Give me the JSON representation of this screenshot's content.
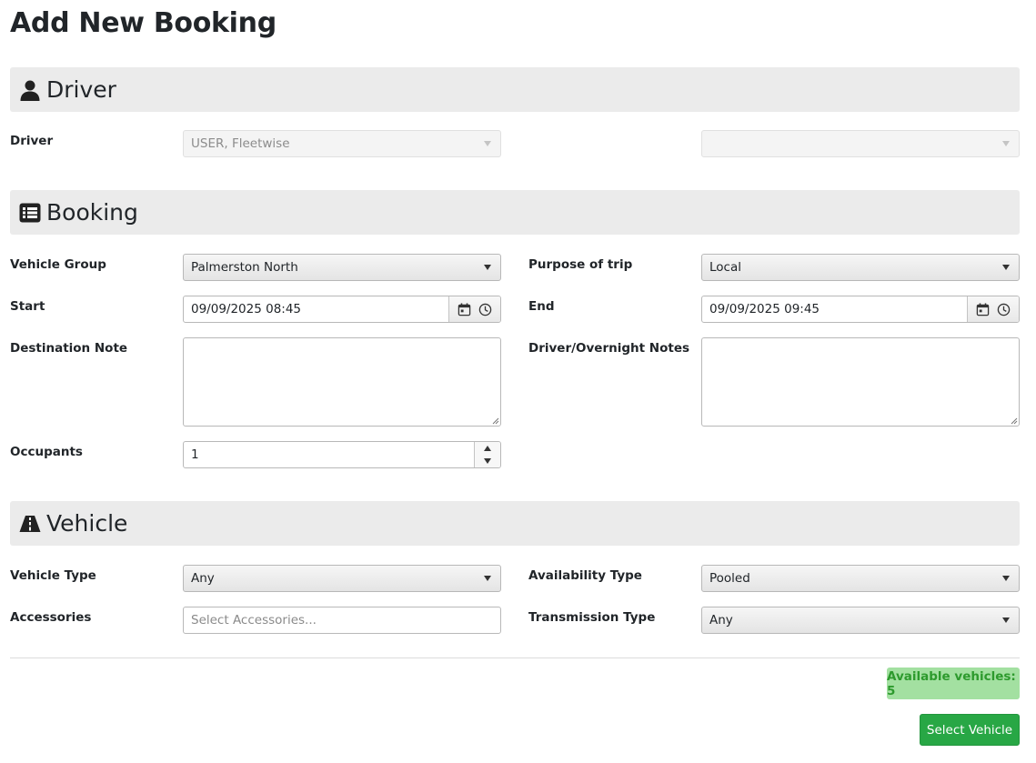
{
  "page": {
    "title": "Add New Booking"
  },
  "sections": {
    "driver": {
      "title": "Driver",
      "icon": "user-icon"
    },
    "booking": {
      "title": "Booking",
      "icon": "list-icon"
    },
    "vehicle": {
      "title": "Vehicle",
      "icon": "road-icon"
    }
  },
  "driver": {
    "label": "Driver",
    "selected": "USER, Fleetwise",
    "secondary_selected": ""
  },
  "booking": {
    "vehicle_group": {
      "label": "Vehicle Group",
      "value": "Palmerston North"
    },
    "purpose": {
      "label": "Purpose of trip",
      "value": "Local"
    },
    "start": {
      "label": "Start",
      "value": "09/09/2025 08:45"
    },
    "end": {
      "label": "End",
      "value": "09/09/2025 09:45"
    },
    "destination_note": {
      "label": "Destination Note",
      "value": ""
    },
    "driver_notes": {
      "label": "Driver/Overnight Notes",
      "value": ""
    },
    "occupants": {
      "label": "Occupants",
      "value": "1"
    }
  },
  "vehicle": {
    "vehicle_type": {
      "label": "Vehicle Type",
      "value": "Any"
    },
    "availability_type": {
      "label": "Availability Type",
      "value": "Pooled"
    },
    "accessories": {
      "label": "Accessories",
      "placeholder": "Select Accessories..."
    },
    "transmission_type": {
      "label": "Transmission Type",
      "value": "Any"
    }
  },
  "footer": {
    "available_vehicles": "Available vehicles: 5",
    "select_button": "Select Vehicle"
  },
  "colors": {
    "section_bg": "#ebebeb",
    "badge_bg": "#a3e0a1",
    "badge_text": "#2d9a2d",
    "primary_button": "#28a745"
  }
}
